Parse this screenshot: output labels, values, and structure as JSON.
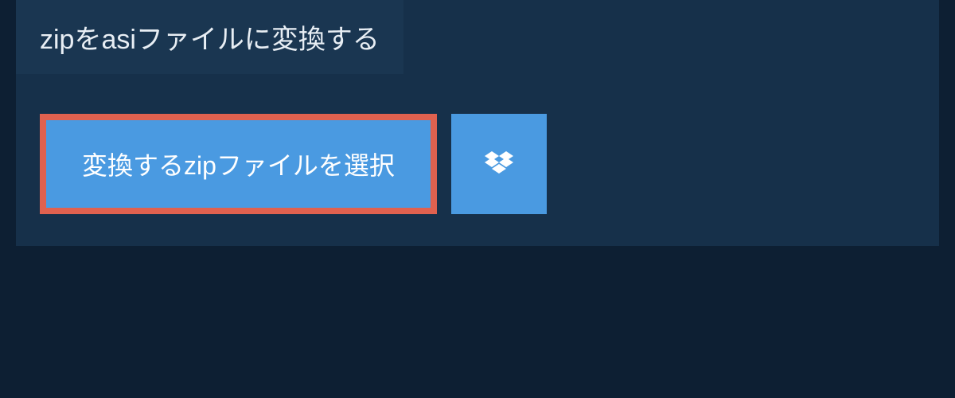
{
  "header": {
    "title": "zipをasiファイルに変換する"
  },
  "actions": {
    "select_file_label": "変換するzipファイルを選択"
  },
  "colors": {
    "page_bg": "#0d1f33",
    "panel_bg": "#16304a",
    "tab_bg": "#1a3651",
    "button_bg": "#4a9ae1",
    "button_border": "#e0614f",
    "text_light": "#e8eef4",
    "text_white": "#ffffff"
  }
}
